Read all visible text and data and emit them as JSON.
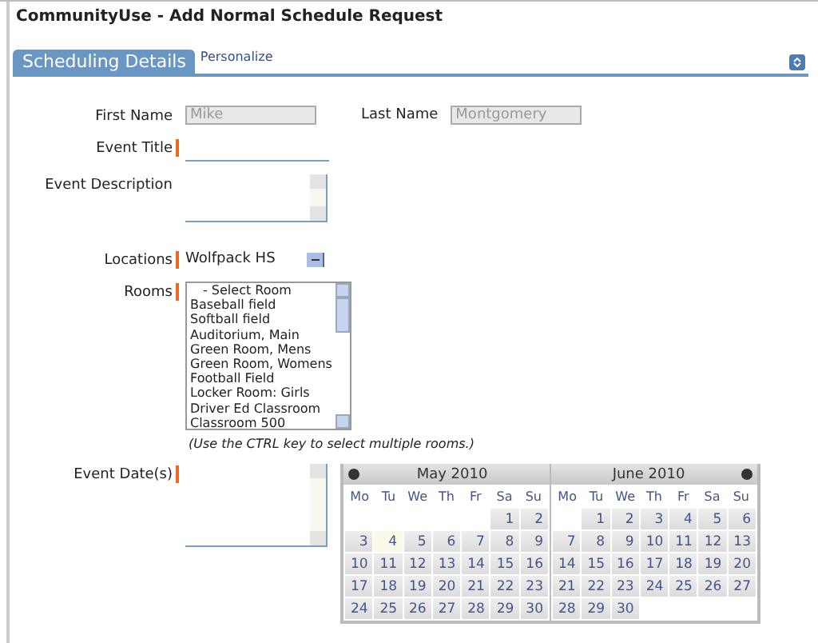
{
  "window": {
    "title": "CommunityUse - Add Normal Schedule Request"
  },
  "tabs": [
    {
      "label": "Scheduling Details",
      "selected": true
    },
    {
      "label": "Personalize",
      "selected": false
    }
  ],
  "form": {
    "first_name": {
      "label": "First Name",
      "value": "Mike",
      "disabled": true
    },
    "last_name": {
      "label": "Last Name",
      "value": "Montgomery",
      "disabled": true
    },
    "event_title": {
      "label": "Event Title",
      "required": true
    },
    "event_description": {
      "label": "Event Description",
      "required": false
    },
    "locations": {
      "label": "Locations",
      "required": true,
      "value": "Wolfpack HS"
    },
    "rooms": {
      "label": "Rooms",
      "required": true,
      "options": [
        "- Select Room",
        "Baseball field",
        "Softball field",
        "Auditorium, Main",
        "Green Room, Mens",
        "Green Room, Womens",
        "Football Field",
        "Locker Room: Girls",
        "Driver Ed Classroom",
        "Classroom 500"
      ],
      "hint": "(Use the CTRL key to select multiple rooms.)"
    },
    "event_dates": {
      "label": "Event Date(s)",
      "required": true
    }
  },
  "calendar": {
    "months": [
      {
        "title": "May 2010",
        "weekdays": [
          "Mo",
          "Tu",
          "We",
          "Th",
          "Fr",
          "Sa",
          "Su"
        ],
        "weeks": [
          [
            {
              "d": "1",
              "today": false
            },
            {
              "d": "2",
              "today": false
            }
          ],
          [
            {
              "d": "3",
              "today": false
            },
            {
              "d": "4",
              "today": true
            },
            {
              "d": "5",
              "today": false
            },
            {
              "d": "6",
              "today": false
            },
            {
              "d": "7",
              "today": false
            },
            {
              "d": "8",
              "today": false
            },
            {
              "d": "9",
              "today": false
            }
          ],
          [
            {
              "d": "10",
              "today": false
            },
            {
              "d": "11",
              "today": false
            },
            {
              "d": "12",
              "today": false
            },
            {
              "d": "13",
              "today": false
            },
            {
              "d": "14",
              "today": false
            },
            {
              "d": "15",
              "today": false
            },
            {
              "d": "16",
              "today": false
            }
          ],
          [
            {
              "d": "17",
              "today": false
            },
            {
              "d": "18",
              "today": false
            },
            {
              "d": "19",
              "today": false
            },
            {
              "d": "20",
              "today": false
            },
            {
              "d": "21",
              "today": false
            },
            {
              "d": "22",
              "today": false
            },
            {
              "d": "23",
              "today": false
            }
          ],
          [
            {
              "d": "24",
              "today": false
            },
            {
              "d": "25",
              "today": false
            },
            {
              "d": "26",
              "today": false
            },
            {
              "d": "27",
              "today": false
            },
            {
              "d": "28",
              "today": false
            },
            {
              "d": "29",
              "today": false
            },
            {
              "d": "30",
              "today": false
            }
          ]
        ]
      },
      {
        "title": "June 2010",
        "weekdays": [
          "Mo",
          "Tu",
          "We",
          "Th",
          "Fr",
          "Sa",
          "Su"
        ],
        "weeks": [
          [
            {
              "d": "1",
              "today": false
            },
            {
              "d": "2",
              "today": false
            },
            {
              "d": "3",
              "today": false
            },
            {
              "d": "4",
              "today": false
            },
            {
              "d": "5",
              "today": false
            },
            {
              "d": "6",
              "today": false
            }
          ],
          [
            {
              "d": "7",
              "today": false
            },
            {
              "d": "8",
              "today": false
            },
            {
              "d": "9",
              "today": false
            },
            {
              "d": "10",
              "today": false
            },
            {
              "d": "11",
              "today": false
            },
            {
              "d": "12",
              "today": false
            },
            {
              "d": "13",
              "today": false
            }
          ],
          [
            {
              "d": "14",
              "today": false
            },
            {
              "d": "15",
              "today": false
            },
            {
              "d": "16",
              "today": false
            },
            {
              "d": "17",
              "today": false
            },
            {
              "d": "18",
              "today": false
            },
            {
              "d": "19",
              "today": false
            },
            {
              "d": "20",
              "today": false
            }
          ],
          [
            {
              "d": "21",
              "today": false
            },
            {
              "d": "22",
              "today": false
            },
            {
              "d": "23",
              "today": false
            },
            {
              "d": "24",
              "today": false
            },
            {
              "d": "25",
              "today": false
            },
            {
              "d": "26",
              "today": false
            },
            {
              "d": "27",
              "today": false
            }
          ],
          [
            {
              "d": "28",
              "today": false
            },
            {
              "d": "29",
              "today": false
            },
            {
              "d": "30",
              "today": false
            }
          ]
        ]
      }
    ]
  }
}
